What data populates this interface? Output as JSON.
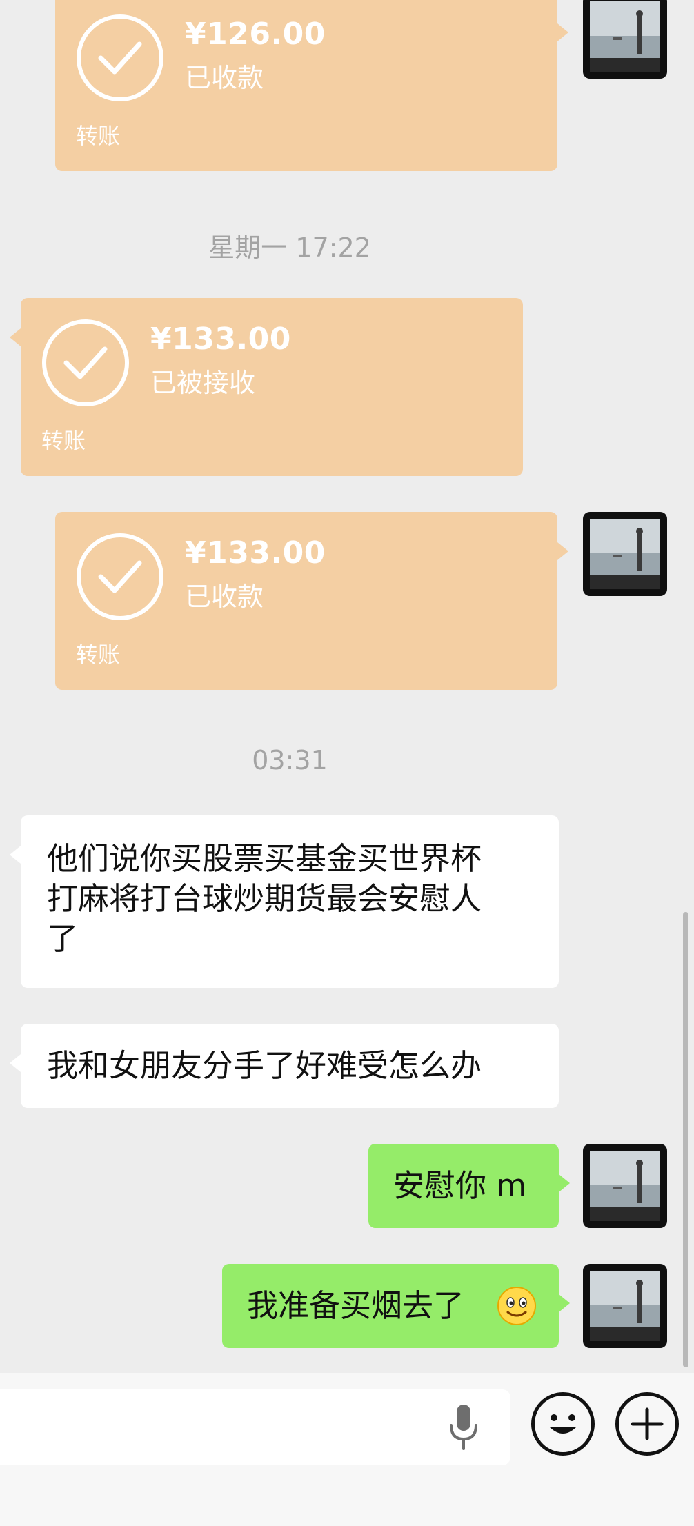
{
  "chat": {
    "transfers": [
      {
        "amount": "¥126.00",
        "status": "已收款",
        "label": "转账",
        "side": "right"
      },
      {
        "amount": "¥133.00",
        "status": "已被接收",
        "label": "转账",
        "side": "left"
      },
      {
        "amount": "¥133.00",
        "status": "已收款",
        "label": "转账",
        "side": "right"
      }
    ],
    "timestamps": [
      "星期一 17:22",
      "03:31"
    ],
    "messages": [
      {
        "side": "left",
        "lines": [
          "他们说你买股票买基金买世界杯",
          "打麻将打台球炒期货最会安慰人",
          "了"
        ]
      },
      {
        "side": "left",
        "text": "我和女朋友分手了好难受怎么办"
      },
      {
        "side": "right",
        "text": "安慰你 m"
      },
      {
        "side": "right",
        "text": "我准备买烟去了",
        "emoji": "smiling-face"
      }
    ]
  },
  "colors": {
    "background": "#ededed",
    "transfer_card": "#f4cfa3",
    "sent_bubble": "#95ec69",
    "received_bubble": "#ffffff",
    "timestamp_text": "#a3a3a3"
  },
  "input_bar": {
    "icons": [
      "microphone-icon",
      "emoji-icon",
      "plus-icon"
    ]
  }
}
